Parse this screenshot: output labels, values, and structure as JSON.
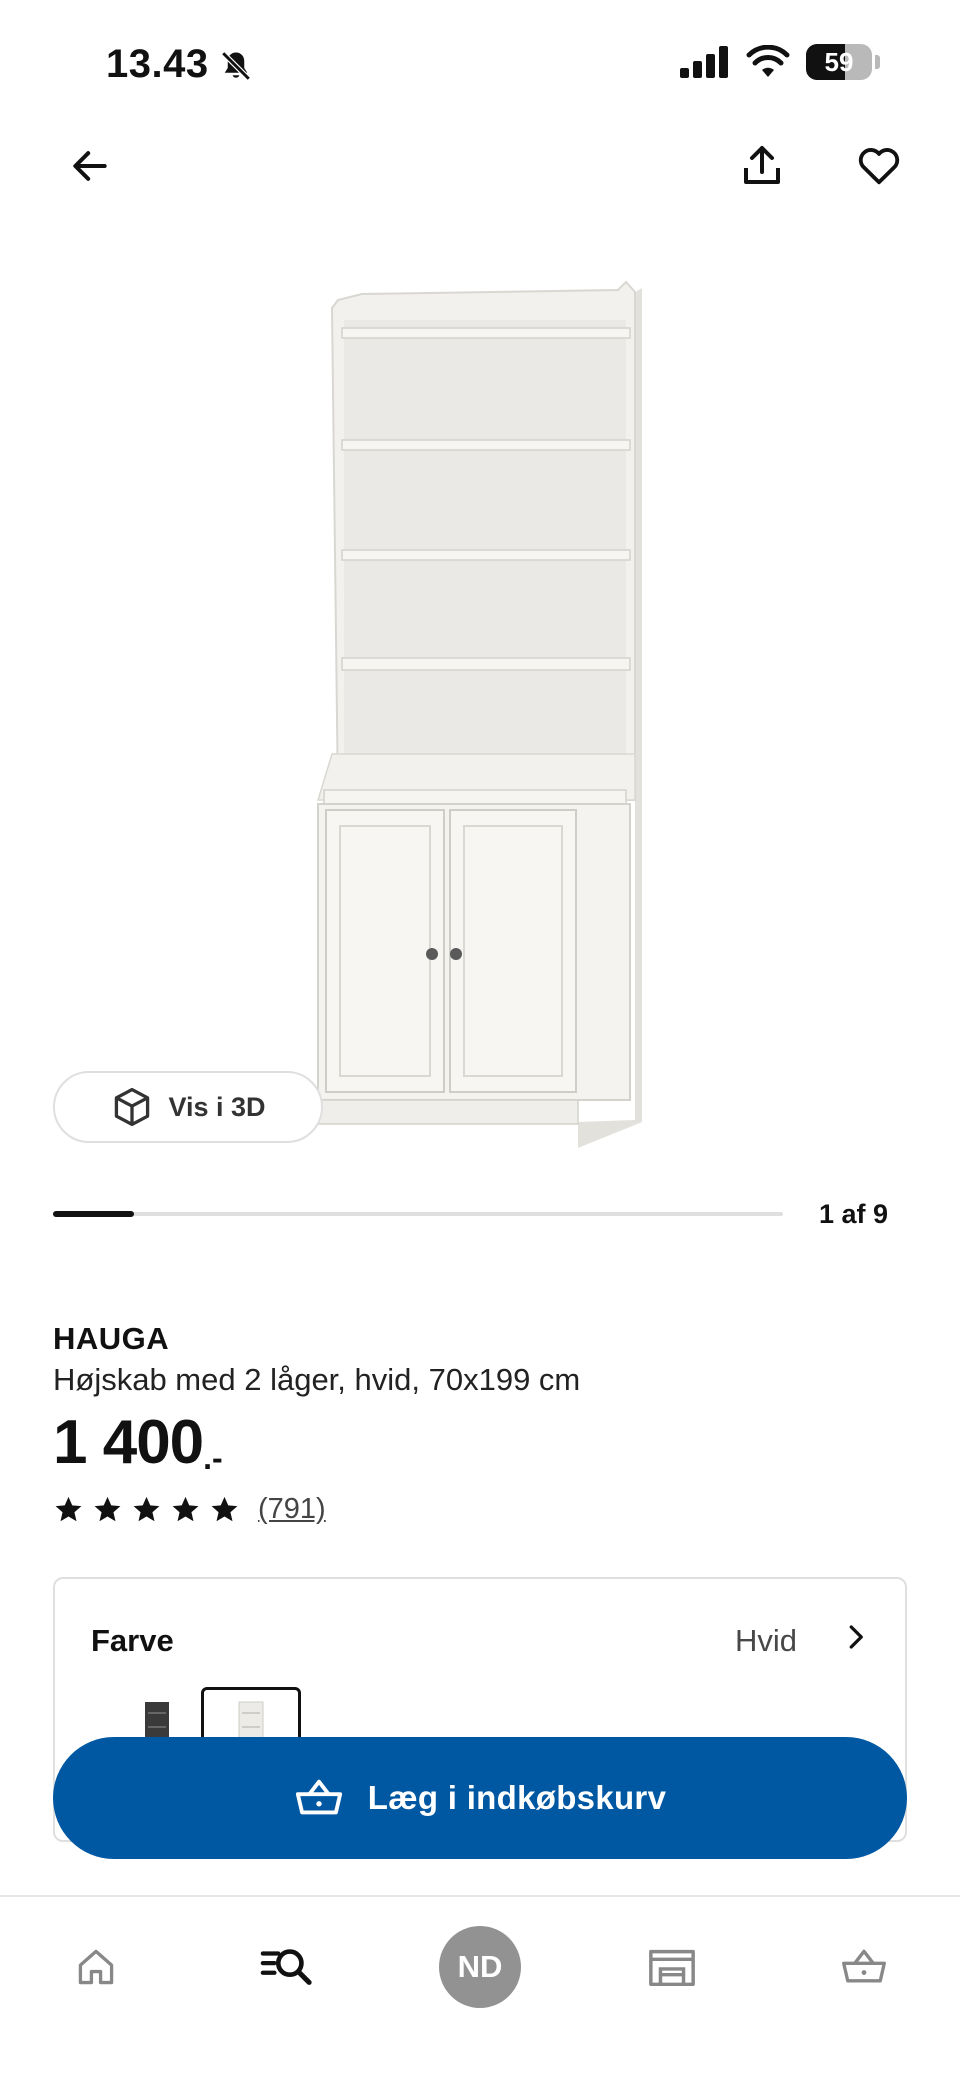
{
  "status_bar": {
    "time": "13.43",
    "battery": "59",
    "battery_level": 0.59
  },
  "header": {
    "back_icon": "arrow-left-icon",
    "share_icon": "share-icon",
    "favorite_icon": "heart-icon"
  },
  "gallery": {
    "view_3d_label": "Vis i 3D",
    "view_3d_icon": "cube-icon",
    "counter": "1 af 9",
    "current": 1,
    "total": 9
  },
  "product": {
    "name": "HAUGA",
    "description": "Højskab med 2 låger, hvid, 70x199 cm",
    "price": "1 400",
    "price_suffix": ".-",
    "rating": 5,
    "review_count": "(791)"
  },
  "color_option": {
    "title": "Farve",
    "value": "Hvid",
    "swatches": [
      {
        "name": "dark-grey",
        "color": "#3a3a3a",
        "selected": false
      },
      {
        "name": "white",
        "color": "#efede8",
        "selected": true
      }
    ]
  },
  "cart": {
    "label": "Læg i indkøbskurv",
    "icon": "basket-icon",
    "color": "#0058a3"
  },
  "tabbar": {
    "items": [
      {
        "icon": "home-icon"
      },
      {
        "icon": "search-list-icon"
      },
      {
        "label": "ND"
      },
      {
        "icon": "store-icon"
      },
      {
        "icon": "basket-icon"
      }
    ]
  }
}
